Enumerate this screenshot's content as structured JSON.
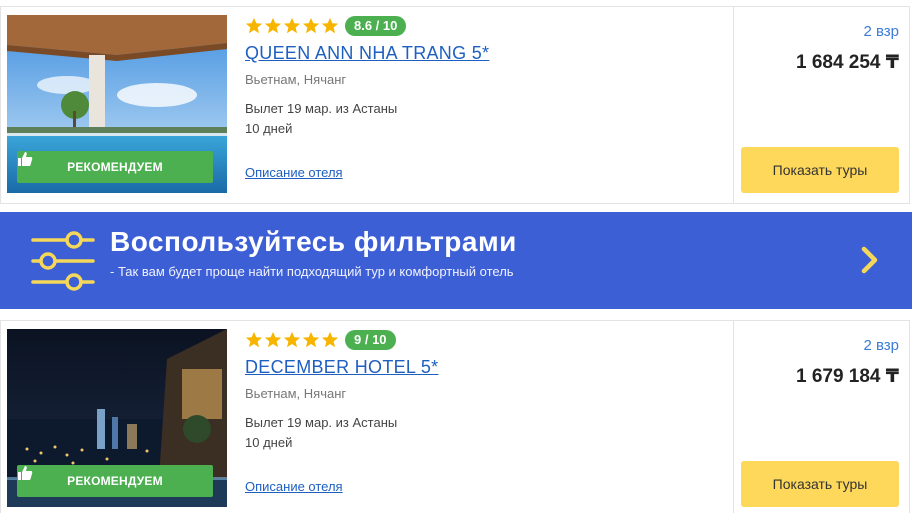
{
  "hotels": [
    {
      "stars": 5,
      "score": "8.6 / 10",
      "name": "QUEEN ANN NHA TRANG 5*",
      "location": "Вьетнам, Нячанг",
      "departure": "Вылет 19 мар. из Астаны",
      "duration": "10 дней",
      "description_link": "Описание отеля",
      "badge": "РЕКОМЕНДУЕМ",
      "pax": "2 взр",
      "price": "1 684 254 ₸",
      "button": "Показать туры"
    },
    {
      "stars": 5,
      "score": "9 / 10",
      "name": "DECEMBER HOTEL 5*",
      "location": "Вьетнам, Нячанг",
      "departure": "Вылет 19 мар. из Астаны",
      "duration": "10 дней",
      "description_link": "Описание отеля",
      "badge": "РЕКОМЕНДУЕМ",
      "pax": "2 взр",
      "price": "1 679 184 ₸",
      "button": "Показать туры"
    }
  ],
  "filter_banner": {
    "title": "Воспользуйтесь фильтрами",
    "subtitle": "- Так вам будет проще найти подходящий тур и комфортный отель",
    "icon": "sliders-icon"
  },
  "colors": {
    "accent_blue": "#3d5fd6",
    "link": "#1e5fc0",
    "score_green": "#4caf50",
    "star": "#f7b500",
    "button_yellow": "#fdd85b"
  }
}
